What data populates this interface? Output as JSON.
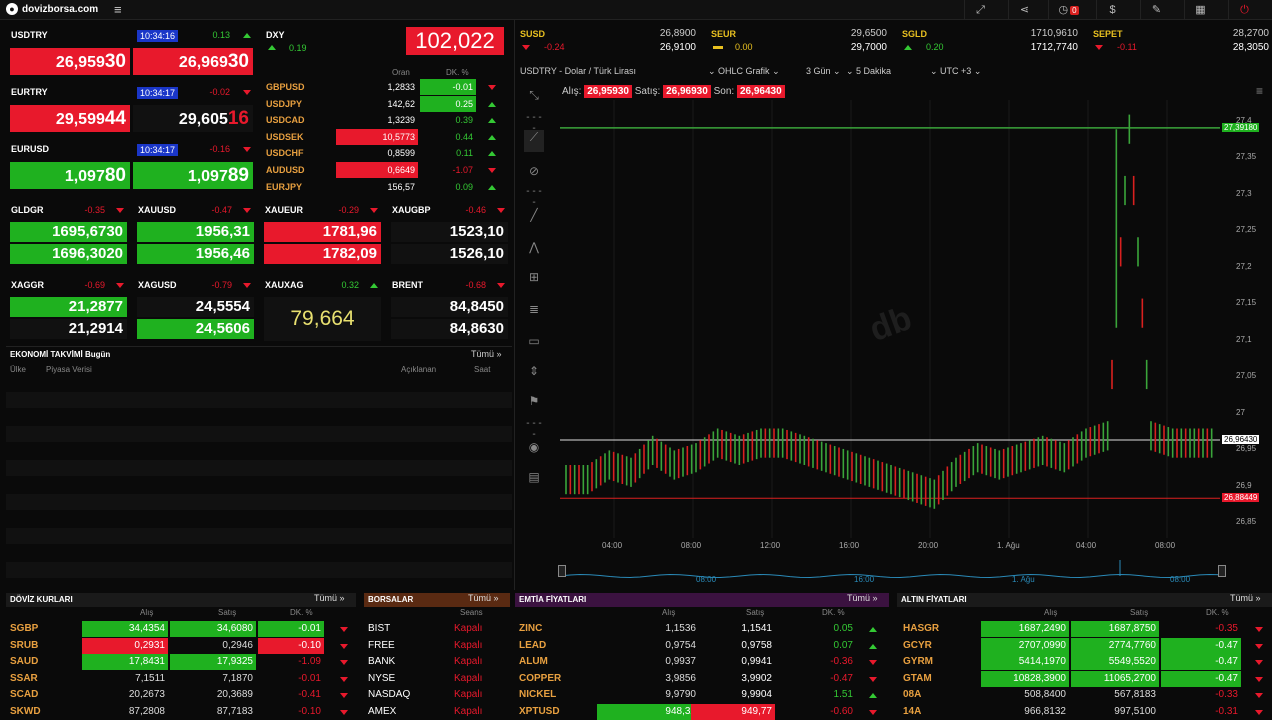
{
  "header": {
    "site": "dovizborsa.com",
    "alert_count": "0"
  },
  "fx_left": [
    {
      "name": "USDTRY",
      "time": "10:34:16",
      "change": "0.13",
      "dir": "up",
      "bid_main": "26,959",
      "bid_tail": "30",
      "bid_color": "red",
      "ask_main": "26,969",
      "ask_tail": "30",
      "ask_color": "red"
    },
    {
      "name": "EURTRY",
      "time": "10:34:17",
      "change": "-0.02",
      "dir": "dn",
      "bid_main": "29,599",
      "bid_tail": "44",
      "bid_color": "red",
      "ask_main": "29,605",
      "ask_tail": "16",
      "ask_color": "dark"
    },
    {
      "name": "EURUSD",
      "time": "10:34:17",
      "change": "-0.16",
      "dir": "dn",
      "bid_main": "1,097",
      "bid_tail": "80",
      "bid_color": "green",
      "ask_main": "1,097",
      "ask_tail": "89",
      "ask_color": "green"
    }
  ],
  "dxy": {
    "name": "DXY",
    "change": "0.19",
    "value": "102,022",
    "col_rate": "Oran",
    "col_chg": "DK. %",
    "rows": [
      {
        "name": "GBPUSD",
        "rate": "1,2833",
        "chg": "-0.01",
        "dir": "dn"
      },
      {
        "name": "USDJPY",
        "rate": "142,62",
        "chg": "0.25",
        "dir": "up"
      },
      {
        "name": "USDCAD",
        "rate": "1,3239",
        "chg": "0.39",
        "dir": "up"
      },
      {
        "name": "USDSEK",
        "rate": "10,5773",
        "chg": "0.44",
        "dir": "up"
      },
      {
        "name": "USDCHF",
        "rate": "0,8599",
        "chg": "0.11",
        "dir": "up"
      },
      {
        "name": "AUDUSD",
        "rate": "0,6649",
        "chg": "-1.07",
        "dir": "dn"
      },
      {
        "name": "EURJPY",
        "rate": "156,57",
        "chg": "0.09",
        "dir": "up"
      }
    ]
  },
  "metals": [
    {
      "name": "GLDGR",
      "change": "-0.35",
      "dir": "dn",
      "v1": "1695,6730",
      "v2": "1696,3020",
      "c1": "green",
      "c2": "green"
    },
    {
      "name": "XAUUSD",
      "change": "-0.47",
      "dir": "dn",
      "v1": "1956,31",
      "v2": "1956,46",
      "c1": "green",
      "c2": "green"
    },
    {
      "name": "XAUEUR",
      "change": "-0.29",
      "dir": "dn",
      "v1": "1781,96",
      "v2": "1782,09",
      "c1": "red",
      "c2": "red"
    },
    {
      "name": "XAUGBP",
      "change": "-0.46",
      "dir": "dn",
      "v1": "1523,10",
      "v2": "1526,10",
      "c1": "dark",
      "c2": "dark"
    }
  ],
  "metals2": [
    {
      "name": "XAGGR",
      "change": "-0.69",
      "dir": "dn",
      "v1": "21,2877",
      "v2": "21,2914",
      "c1": "green",
      "c2": "dark"
    },
    {
      "name": "XAGUSD",
      "change": "-0.79",
      "dir": "dn",
      "v1": "24,5554",
      "v2": "24,5606",
      "c1": "dark",
      "c2": "green"
    },
    {
      "name": "XAUXAG",
      "change": "0.32",
      "dir": "up",
      "v1": "79,664"
    },
    {
      "name": "BRENT",
      "change": "-0.68",
      "dir": "dn",
      "v1": "84,8450",
      "v2": "84,8630",
      "c1": "dark",
      "c2": "dark"
    }
  ],
  "econ": {
    "title": "EKONOMİ TAKVİMİ",
    "sub": "Bugün",
    "all": "Tümü »",
    "col_country": "Ülke",
    "col_data": "Piyasa Verisi",
    "col_announced": "Açıklanan",
    "col_time": "Saat"
  },
  "top_strip": [
    {
      "name": "SUSD",
      "change": "-0.24",
      "dir": "dn",
      "v1": "26,8900",
      "v2": "26,9100"
    },
    {
      "name": "SEUR",
      "change": "0.00",
      "dir": "eq",
      "v1": "29,6500",
      "v2": "29,7000"
    },
    {
      "name": "SGLD",
      "change": "0.20",
      "dir": "up",
      "v1": "1710,9610",
      "v2": "1712,7740"
    },
    {
      "name": "SEPET",
      "change": "-0.11",
      "dir": "dn",
      "v1": "28,2700",
      "v2": "28,3050"
    }
  ],
  "chart": {
    "instrument": "USDTRY - Dolar / Türk Lirası",
    "type": "OHLC Grafik",
    "range": "3 Gün",
    "interval": "5 Dakika",
    "tz": "UTC +3",
    "bid_label": "Alış:",
    "bid": "26,95930",
    "ask_label": "Satış:",
    "ask": "26,96930",
    "last_label": "Son:",
    "last": "26,96430",
    "watermark": "db",
    "yticks": [
      "27,4",
      "27,35",
      "27,3",
      "27,25",
      "27,2",
      "27,15",
      "27,1",
      "27,05",
      "27",
      "26,95",
      "26,9",
      "26,85"
    ],
    "xticks": [
      "04:00",
      "08:00",
      "12:00",
      "16:00",
      "20:00",
      "1. Ağu",
      "04:00",
      "08:00"
    ],
    "nav_ticks": [
      "08:00",
      "16:00",
      "1. Ağu",
      "08:00"
    ],
    "tag_high": "27,39180",
    "tag_last": "26,96430",
    "tag_low": "26,88449"
  },
  "chart_data": {
    "type": "ohlc",
    "ylim": [
      26.83,
      27.43
    ],
    "reference_lines": [
      27.3918,
      26.9643,
      26.88449
    ],
    "series": [
      {
        "values": [
          26.91,
          26.93,
          26.92,
          26.95,
          26.93,
          26.94,
          26.96,
          26.95,
          26.96,
          26.96,
          26.95,
          26.94,
          26.93,
          26.92,
          26.91,
          26.9,
          26.89,
          26.92,
          26.94,
          26.93,
          26.94,
          26.95,
          26.94,
          26.96,
          26.97,
          27.39,
          26.97,
          26.96,
          26.96,
          26.96
        ]
      }
    ]
  },
  "doviz": {
    "title": "DÖVİZ KURLARI",
    "all": "Tümü »",
    "c1": "Alış",
    "c2": "Satış",
    "c3": "DK. %",
    "rows": [
      {
        "n": "SGBP",
        "a": "34,4354",
        "s": "34,6080",
        "c": "-0.01",
        "ac": "green",
        "sc": "green",
        "cc": "green"
      },
      {
        "n": "SRUB",
        "a": "0,2931",
        "s": "0,2946",
        "c": "-0.10",
        "ac": "red",
        "sc": "dark",
        "cc": "red"
      },
      {
        "n": "SAUD",
        "a": "17,8431",
        "s": "17,9325",
        "c": "-1.09",
        "ac": "green",
        "sc": "green",
        "cc": "none"
      },
      {
        "n": "SSAR",
        "a": "7,1511",
        "s": "7,1870",
        "c": "-0.01",
        "ac": "dark",
        "sc": "dark",
        "cc": "none"
      },
      {
        "n": "SCAD",
        "a": "20,2673",
        "s": "20,3689",
        "c": "-0.41",
        "ac": "dark",
        "sc": "dark",
        "cc": "none"
      },
      {
        "n": "SKWD",
        "a": "87,2808",
        "s": "87,7183",
        "c": "-0.10",
        "ac": "dark",
        "sc": "dark",
        "cc": "none"
      }
    ]
  },
  "borsalar": {
    "title": "BORSALAR",
    "all": "Tümü »",
    "c1": "Seans",
    "rows": [
      {
        "n": "BIST",
        "s": "Kapalı"
      },
      {
        "n": "FREE",
        "s": "Kapalı"
      },
      {
        "n": "BANK",
        "s": "Kapalı"
      },
      {
        "n": "NYSE",
        "s": "Kapalı"
      },
      {
        "n": "NASDAQ",
        "s": "Kapalı"
      },
      {
        "n": "AMEX",
        "s": "Kapalı"
      }
    ]
  },
  "emtia": {
    "title": "EMTİA FİYATLARI",
    "all": "Tümü »",
    "c1": "Alış",
    "c2": "Satış",
    "c3": "DK. %",
    "rows": [
      {
        "n": "ZINC",
        "a": "1,1536",
        "s": "1,1541",
        "c": "0.05",
        "dir": "up"
      },
      {
        "n": "LEAD",
        "a": "0,9754",
        "s": "0,9758",
        "c": "0.07",
        "dir": "up"
      },
      {
        "n": "ALUM",
        "a": "0,9937",
        "s": "0,9941",
        "c": "-0.36",
        "dir": "dn"
      },
      {
        "n": "COPPER",
        "a": "3,9856",
        "s": "3,9902",
        "c": "-0.47",
        "dir": "dn"
      },
      {
        "n": "NICKEL",
        "a": "9,9790",
        "s": "9,9904",
        "c": "1.51",
        "dir": "up"
      },
      {
        "n": "XPTUSD",
        "a": "948,32",
        "s": "949,77",
        "c": "-0.60",
        "dir": "dn"
      }
    ]
  },
  "altin": {
    "title": "ALTIN FİYATLARI",
    "all": "Tümü »",
    "c1": "Alış",
    "c2": "Satış",
    "c3": "DK. %",
    "rows": [
      {
        "n": "HASGR",
        "a": "1687,2490",
        "s": "1687,8750",
        "c": "-0.35",
        "ac": "green",
        "sc": "green",
        "cc": "none"
      },
      {
        "n": "GCYR",
        "a": "2707,0990",
        "s": "2774,7760",
        "c": "-0.47",
        "ac": "green",
        "sc": "green",
        "cc": "green"
      },
      {
        "n": "GYRM",
        "a": "5414,1970",
        "s": "5549,5520",
        "c": "-0.47",
        "ac": "green",
        "sc": "green",
        "cc": "green"
      },
      {
        "n": "GTAM",
        "a": "10828,3900",
        "s": "11065,2700",
        "c": "-0.47",
        "ac": "green",
        "sc": "green",
        "cc": "green"
      },
      {
        "n": "08A",
        "a": "508,8400",
        "s": "567,8183",
        "c": "-0.33",
        "ac": "dark",
        "sc": "dark",
        "cc": "none"
      },
      {
        "n": "14A",
        "a": "966,8132",
        "s": "997,5100",
        "c": "-0.31",
        "ac": "dark",
        "sc": "dark",
        "cc": "none"
      }
    ]
  }
}
